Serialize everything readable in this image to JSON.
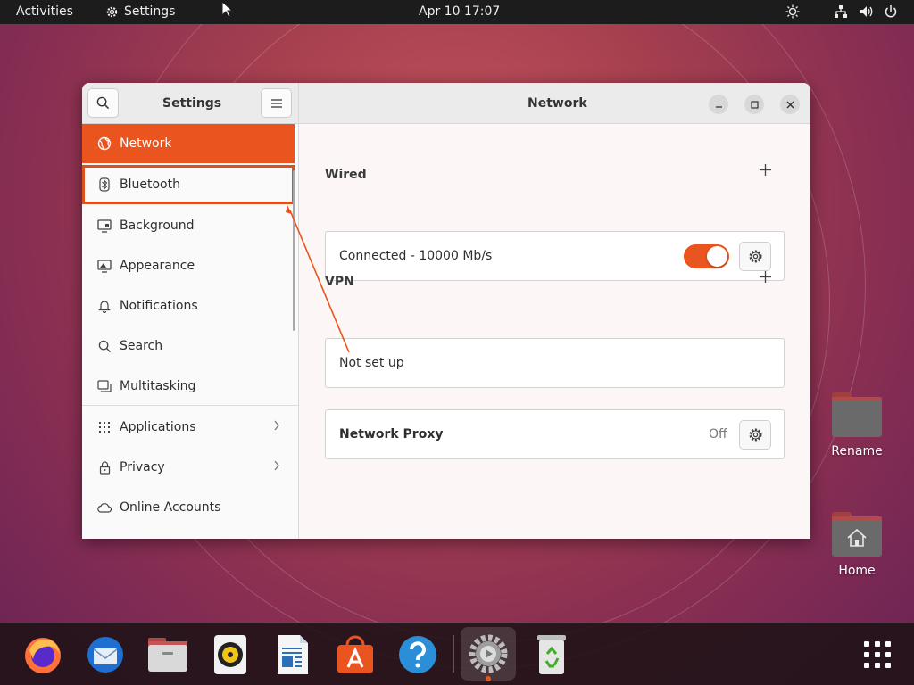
{
  "topbar": {
    "activities": "Activities",
    "app_menu": "Settings",
    "clock": "Apr 10  17:07"
  },
  "window": {
    "sidebar_title": "Settings",
    "page_title": "Network"
  },
  "sidebar": {
    "items": [
      {
        "label": "Network",
        "icon": "network-icon"
      },
      {
        "label": "Bluetooth",
        "icon": "bluetooth-icon"
      },
      {
        "label": "Background",
        "icon": "background-icon"
      },
      {
        "label": "Appearance",
        "icon": "appearance-icon"
      },
      {
        "label": "Notifications",
        "icon": "bell-icon"
      },
      {
        "label": "Search",
        "icon": "search-icon"
      },
      {
        "label": "Multitasking",
        "icon": "multitasking-icon"
      },
      {
        "label": "Applications",
        "icon": "grid-icon"
      },
      {
        "label": "Privacy",
        "icon": "lock-icon"
      },
      {
        "label": "Online Accounts",
        "icon": "cloud-icon"
      }
    ]
  },
  "network": {
    "wired": {
      "title": "Wired",
      "status": "Connected - 10000 Mb/s",
      "toggle_on": true
    },
    "vpn": {
      "title": "VPN",
      "status": "Not set up"
    },
    "proxy": {
      "label": "Network Proxy",
      "state": "Off"
    }
  },
  "desktop": {
    "icons": [
      {
        "label": "Rename"
      },
      {
        "label": "Home"
      }
    ]
  },
  "dock": {
    "apps": [
      "firefox",
      "thunderbird",
      "files",
      "rhythmbox",
      "libreoffice-writer",
      "ubuntu-software",
      "help",
      "settings",
      "trash",
      "show-applications"
    ]
  },
  "colors": {
    "accent": "#e9541f",
    "topbar": "#1c1c1c"
  }
}
